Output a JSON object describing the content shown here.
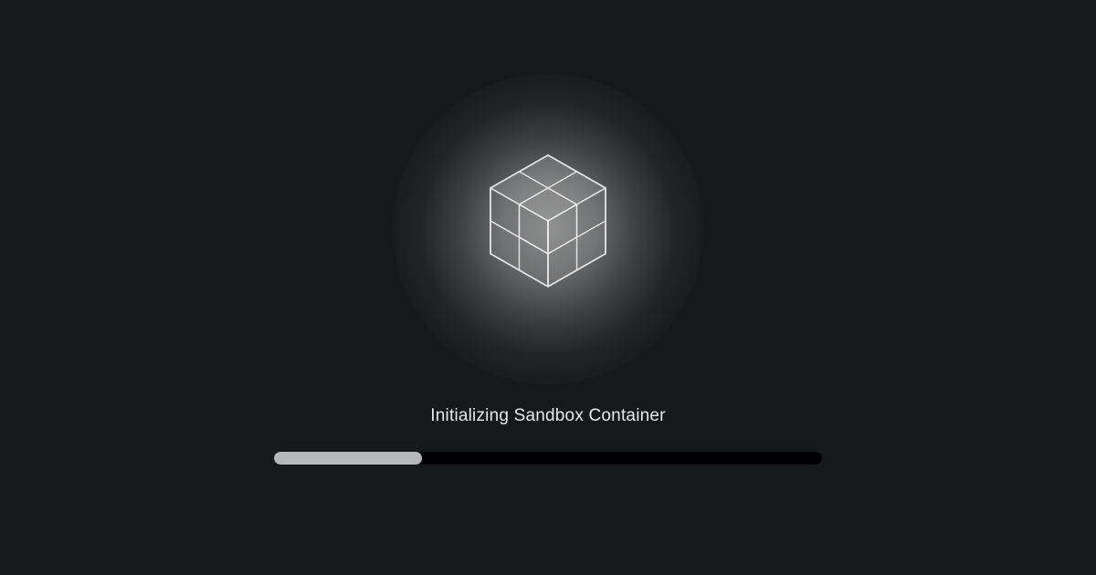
{
  "loading": {
    "status_text": "Initializing Sandbox Container",
    "progress_percent": 27,
    "icon_name": "cube-3d",
    "colors": {
      "background": "#17181a",
      "text": "#e8e8e8",
      "progress_fill": "#b8b8b8",
      "progress_track": "#000000"
    }
  }
}
